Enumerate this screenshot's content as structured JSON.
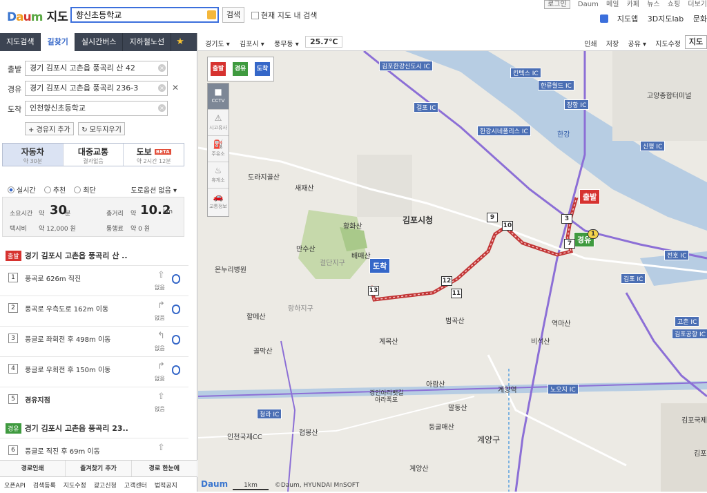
{
  "header": {
    "logo": {
      "d": "D",
      "a": "a",
      "u": "u",
      "m": "m",
      "title": "지도"
    },
    "search_value": "향신초등학교",
    "search_button": "검색",
    "in_map_search": "현재 지도 내 검색",
    "top_links": [
      "로그인",
      "Daum",
      "메일",
      "카페",
      "뉴스",
      "쇼핑",
      "더보기"
    ],
    "app_links": [
      "지도앱",
      "3D지도lab",
      "문화"
    ]
  },
  "left_nav": {
    "tabs": [
      "지도검색",
      "길찾기",
      "실시간버스",
      "지하철노선"
    ],
    "active_tab": "길찾기",
    "star": "★"
  },
  "route": {
    "origin_label": "출발",
    "origin_value": "경기 김포시 고촌읍 풍곡리 산 42",
    "waypoint_label": "경유",
    "waypoint_value": "경기 김포시 고촌읍 풍곡리 236-3",
    "dest_label": "도착",
    "dest_value": "인천향신초등학교",
    "add_waypoint": "+ 경유지 추가",
    "clear_all": "↻ 모두지우기"
  },
  "modes": [
    {
      "name": "자동차",
      "sub": "약 30분"
    },
    {
      "name": "대중교통",
      "sub": "결과없음"
    },
    {
      "name": "도보",
      "sub": "약 2시간 12분",
      "badge": "BETA"
    }
  ],
  "options": {
    "realtime": "실시간",
    "recommend": "추천",
    "shortest": "최단",
    "road_option": "도로옵션 없음 ▾"
  },
  "summary": {
    "time_label": "소요시간",
    "time_prefix": "약",
    "time_value": "30",
    "time_unit": "분",
    "dist_label": "총거리",
    "dist_prefix": "약",
    "dist_value": "10.2",
    "dist_unit": "km",
    "taxi_label": "택시비",
    "taxi_value": "약   12,000 원",
    "toll_label": "통행료",
    "toll_value": "약   0 원"
  },
  "steps": {
    "origin_tag": "출발",
    "origin_text": "경기 김포시 고촌읍 풍곡리 산 ..",
    "waypoint_tag": "경유",
    "waypoint_text": "경기 김포시 고촌읍 풍곡리 23..",
    "items": [
      {
        "num": "1",
        "text": "풍곡로 626m 직진",
        "cond": "없음"
      },
      {
        "num": "2",
        "text": "풍곡로 우측도로 162m 이동",
        "cond": "없음"
      },
      {
        "num": "3",
        "text": "풍글로 좌회전 후 498m 이동",
        "cond": "없음"
      },
      {
        "num": "4",
        "text": "풍글로 우회전 후 150m 이동",
        "cond": "없음"
      },
      {
        "num": "5",
        "text": "경유지점",
        "cond": "없음"
      },
      {
        "num": "6",
        "text": "풍글로 직진 후 69m 이동",
        "cond": ""
      }
    ]
  },
  "left_footer": {
    "actions": [
      "경로인쇄",
      "즐겨찾기 추가",
      "경로 한눈에"
    ],
    "links": [
      "오픈API",
      "검색등록",
      "지도수정",
      "광고신청",
      "고객센터",
      "법적공지"
    ]
  },
  "map_top": {
    "breadcrumb": [
      "경기도 ▾",
      "김포시 ▾",
      "풍무동 ▾"
    ],
    "temperature": "25.7℃",
    "tools": [
      "인쇄",
      "저장",
      "공유 ▾",
      "지도수정"
    ],
    "map_button": "지도"
  },
  "map_tools": [
    {
      "label": "CCTV",
      "icon": "cctv-icon"
    },
    {
      "label": "시고유사",
      "icon": "accident-icon"
    },
    {
      "label": "주유소",
      "icon": "gas-station-icon"
    },
    {
      "label": "휴게소",
      "icon": "rest-area-icon"
    },
    {
      "label": "교통정보",
      "icon": "traffic-icon"
    }
  ],
  "marker_palette": [
    "출발",
    "경유",
    "도착"
  ],
  "map_labels": {
    "places": [
      "도라지골산",
      "새재산",
      "황화산",
      "만수산",
      "배매산",
      "김포시청",
      "걸단지구",
      "온누리병원",
      "랑하지구",
      "할메산",
      "골막산",
      "계목산",
      "범곡산",
      "아람산",
      "역마산",
      "비석산",
      "계양역",
      "경인아라뱃길",
      "아라폭포",
      "말동산",
      "둥굴매산",
      "계양구",
      "인천국제CC",
      "협봉산",
      "계양산",
      "고양종합터미널",
      "한강",
      "김포국제",
      "김포1"
    ],
    "interchanges": [
      "김포한강신도시 IC",
      "킨텍스 IC",
      "한류월드 IC",
      "장항 IC",
      "걸포 IC",
      "한강시네폴리스 IC",
      "신평 IC",
      "전호 IC",
      "김포 IC",
      "고촌 IC",
      "김포공항 IC",
      "노오지 IC",
      "청라 IC"
    ],
    "route_markers": {
      "start": "출발",
      "via": "경유",
      "end": "도착"
    },
    "waypoints": [
      "1",
      "3",
      "7",
      "9",
      "10",
      "11",
      "12",
      "13"
    ]
  },
  "map_footer": {
    "logo": "Daum",
    "scale": "1km",
    "copyright": "©Daum, HYUNDAI MnSOFT"
  }
}
